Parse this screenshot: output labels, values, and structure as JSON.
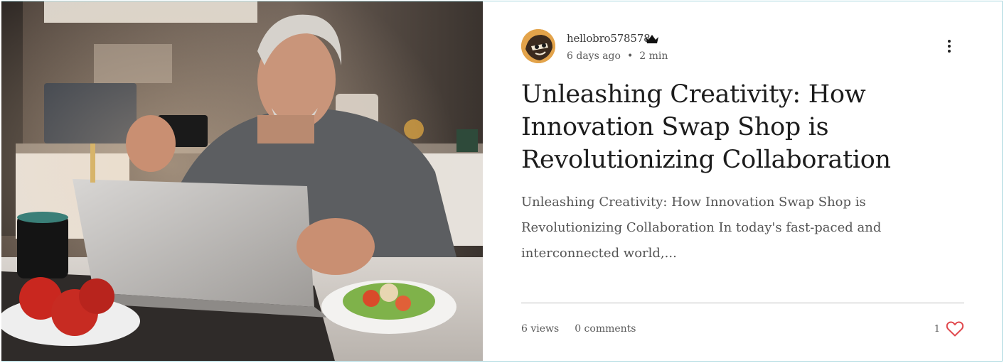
{
  "post": {
    "image_alt": "Older man holding a card in front of a laptop in a kitchen",
    "author": {
      "name": "hellobro578578",
      "badge_icon": "crown-icon"
    },
    "published": "6 days ago",
    "separator": "•",
    "read_time": "2 min",
    "more_icon": "more-vertical-icon",
    "title": "Unleashing Creativity: How Innovation Swap Shop is Revolutionizing Collaboration",
    "excerpt": "Unleashing Creativity: How Innovation Swap Shop is Revolutionizing Collaboration In today's fast-paced and interconnected world,...",
    "views": "6 views",
    "comments": "0 comments",
    "likes": "1",
    "like_icon": "heart-outline-icon"
  },
  "colors": {
    "border": "#a9d7de",
    "heart": "#e0474c",
    "title": "#1c1c1c",
    "text_muted": "#5b5b5b"
  }
}
